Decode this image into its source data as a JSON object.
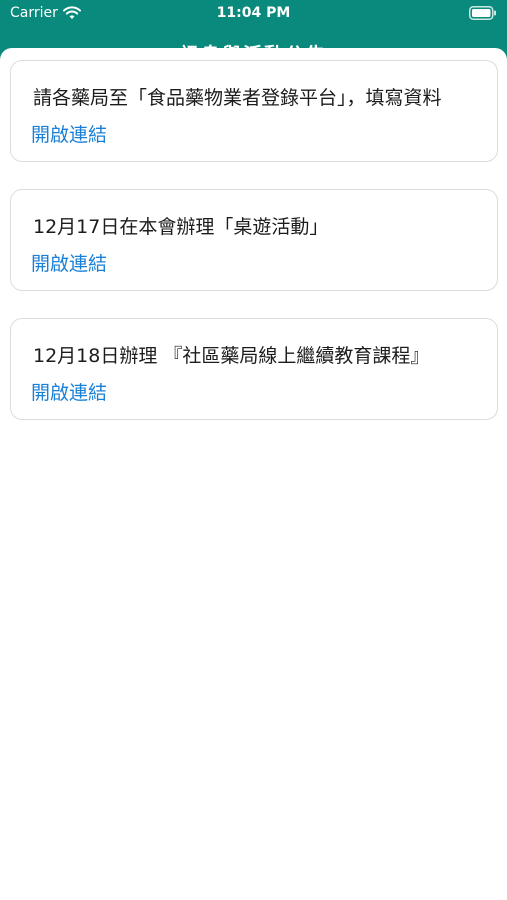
{
  "status_bar": {
    "carrier": "Carrier",
    "time": "11:04 PM",
    "wifi_icon": "wifi-icon",
    "battery_icon": "battery-icon"
  },
  "nav": {
    "title": "訊息與活動公告"
  },
  "colors": {
    "header": "#0a8a7c",
    "link": "#1a7fd6",
    "card_border": "#dcdcdc"
  },
  "announcements": [
    {
      "title": "請各藥局至「食品藥物業者登錄平台」，填寫資料",
      "link_label": "開啟連結"
    },
    {
      "title": "12月17日在本會辦理「桌遊活動」",
      "link_label": "開啟連結"
    },
    {
      "title": "12月18日辦理 『社區藥局線上繼續教育課程』",
      "link_label": "開啟連結"
    }
  ]
}
